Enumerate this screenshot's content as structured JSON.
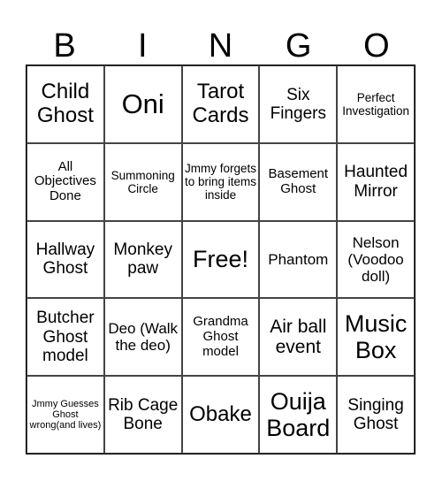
{
  "header": [
    "B",
    "I",
    "N",
    "G",
    "O"
  ],
  "cells": [
    "Child Ghost",
    "Oni",
    "Tarot Cards",
    "Six Fingers",
    "Perfect Investigation",
    "All Objectives Done",
    "Summoning Circle",
    "Jmmy forgets to bring items inside",
    "Basement Ghost",
    "Haunted Mirror",
    "Hallway Ghost",
    "Monkey paw",
    "Free!",
    "Phantom",
    "Nelson (Voodoo doll)",
    "Butcher Ghost model",
    "Deo (Walk the deo)",
    "Grandma Ghost model",
    "Air ball event",
    "Music Box",
    "Jmmy Guesses Ghost wrong(and lives)",
    "Rib Cage Bone",
    "Obake",
    "Ouija Board",
    "Singing Ghost"
  ]
}
